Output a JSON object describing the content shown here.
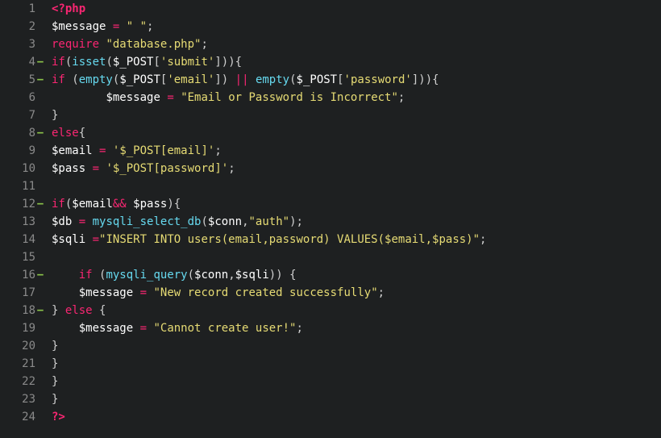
{
  "lines": [
    {
      "n": 1,
      "mark": "",
      "tokens": [
        {
          "c": "tk-tag",
          "t": "<?php"
        }
      ]
    },
    {
      "n": 2,
      "mark": "",
      "tokens": [
        {
          "c": "tk-var",
          "t": "$message"
        },
        {
          "c": "tk-plain",
          "t": " "
        },
        {
          "c": "tk-op",
          "t": "="
        },
        {
          "c": "tk-plain",
          "t": " "
        },
        {
          "c": "tk-str",
          "t": "\" \""
        },
        {
          "c": "tk-punc",
          "t": ";"
        }
      ]
    },
    {
      "n": 3,
      "mark": "",
      "tokens": [
        {
          "c": "tk-keyword",
          "t": "require"
        },
        {
          "c": "tk-plain",
          "t": " "
        },
        {
          "c": "tk-str",
          "t": "\"database.php\""
        },
        {
          "c": "tk-punc",
          "t": ";"
        }
      ]
    },
    {
      "n": 4,
      "mark": "−",
      "tokens": [
        {
          "c": "tk-keyword",
          "t": "if"
        },
        {
          "c": "tk-punc",
          "t": "("
        },
        {
          "c": "tk-func",
          "t": "isset"
        },
        {
          "c": "tk-punc",
          "t": "("
        },
        {
          "c": "tk-var",
          "t": "$_POST"
        },
        {
          "c": "tk-punc",
          "t": "["
        },
        {
          "c": "tk-str",
          "t": "'submit'"
        },
        {
          "c": "tk-punc",
          "t": "])){"
        }
      ]
    },
    {
      "n": 5,
      "mark": "−",
      "tokens": [
        {
          "c": "tk-keyword",
          "t": "if"
        },
        {
          "c": "tk-plain",
          "t": " ("
        },
        {
          "c": "tk-func",
          "t": "empty"
        },
        {
          "c": "tk-punc",
          "t": "("
        },
        {
          "c": "tk-var",
          "t": "$_POST"
        },
        {
          "c": "tk-punc",
          "t": "["
        },
        {
          "c": "tk-str",
          "t": "'email'"
        },
        {
          "c": "tk-punc",
          "t": "]) "
        },
        {
          "c": "tk-op",
          "t": "||"
        },
        {
          "c": "tk-plain",
          "t": " "
        },
        {
          "c": "tk-func",
          "t": "empty"
        },
        {
          "c": "tk-punc",
          "t": "("
        },
        {
          "c": "tk-var",
          "t": "$_POST"
        },
        {
          "c": "tk-punc",
          "t": "["
        },
        {
          "c": "tk-str",
          "t": "'password'"
        },
        {
          "c": "tk-punc",
          "t": "])){"
        }
      ]
    },
    {
      "n": 6,
      "mark": "",
      "tokens": [
        {
          "c": "tk-plain",
          "t": "        "
        },
        {
          "c": "tk-var",
          "t": "$message"
        },
        {
          "c": "tk-plain",
          "t": " "
        },
        {
          "c": "tk-op",
          "t": "="
        },
        {
          "c": "tk-plain",
          "t": " "
        },
        {
          "c": "tk-str",
          "t": "\"Email or Password is Incorrect\""
        },
        {
          "c": "tk-punc",
          "t": ";"
        }
      ]
    },
    {
      "n": 7,
      "mark": "",
      "tokens": [
        {
          "c": "tk-punc",
          "t": "}"
        }
      ]
    },
    {
      "n": 8,
      "mark": "−",
      "tokens": [
        {
          "c": "tk-keyword",
          "t": "else"
        },
        {
          "c": "tk-punc",
          "t": "{"
        }
      ]
    },
    {
      "n": 9,
      "mark": "",
      "tokens": [
        {
          "c": "tk-var",
          "t": "$email"
        },
        {
          "c": "tk-plain",
          "t": " "
        },
        {
          "c": "tk-op",
          "t": "="
        },
        {
          "c": "tk-plain",
          "t": " "
        },
        {
          "c": "tk-str",
          "t": "'$_POST[email]'"
        },
        {
          "c": "tk-punc",
          "t": ";"
        }
      ]
    },
    {
      "n": 10,
      "mark": "",
      "tokens": [
        {
          "c": "tk-var",
          "t": "$pass"
        },
        {
          "c": "tk-plain",
          "t": " "
        },
        {
          "c": "tk-op",
          "t": "="
        },
        {
          "c": "tk-plain",
          "t": " "
        },
        {
          "c": "tk-str",
          "t": "'$_POST[password]'"
        },
        {
          "c": "tk-punc",
          "t": ";"
        }
      ]
    },
    {
      "n": 11,
      "mark": "",
      "tokens": [
        {
          "c": "tk-plain",
          "t": ""
        }
      ]
    },
    {
      "n": 12,
      "mark": "−",
      "tokens": [
        {
          "c": "tk-keyword",
          "t": "if"
        },
        {
          "c": "tk-punc",
          "t": "("
        },
        {
          "c": "tk-var",
          "t": "$email"
        },
        {
          "c": "tk-op",
          "t": "&&"
        },
        {
          "c": "tk-plain",
          "t": " "
        },
        {
          "c": "tk-var",
          "t": "$pass"
        },
        {
          "c": "tk-punc",
          "t": "){"
        }
      ]
    },
    {
      "n": 13,
      "mark": "",
      "tokens": [
        {
          "c": "tk-var",
          "t": "$db"
        },
        {
          "c": "tk-plain",
          "t": " "
        },
        {
          "c": "tk-op",
          "t": "="
        },
        {
          "c": "tk-plain",
          "t": " "
        },
        {
          "c": "tk-func",
          "t": "mysqli_select_db"
        },
        {
          "c": "tk-punc",
          "t": "("
        },
        {
          "c": "tk-var",
          "t": "$conn"
        },
        {
          "c": "tk-punc",
          "t": ","
        },
        {
          "c": "tk-str",
          "t": "\"auth\""
        },
        {
          "c": "tk-punc",
          "t": ");"
        }
      ]
    },
    {
      "n": 14,
      "mark": "",
      "tokens": [
        {
          "c": "tk-var",
          "t": "$sqli"
        },
        {
          "c": "tk-plain",
          "t": " "
        },
        {
          "c": "tk-op",
          "t": "="
        },
        {
          "c": "tk-str",
          "t": "\"INSERT INTO users(email,password) VALUES($email,$pass)\""
        },
        {
          "c": "tk-punc",
          "t": ";"
        }
      ]
    },
    {
      "n": 15,
      "mark": "",
      "tokens": [
        {
          "c": "tk-plain",
          "t": ""
        }
      ]
    },
    {
      "n": 16,
      "mark": "−",
      "tokens": [
        {
          "c": "tk-plain",
          "t": "    "
        },
        {
          "c": "tk-keyword",
          "t": "if"
        },
        {
          "c": "tk-plain",
          "t": " ("
        },
        {
          "c": "tk-func",
          "t": "mysqli_query"
        },
        {
          "c": "tk-punc",
          "t": "("
        },
        {
          "c": "tk-var",
          "t": "$conn"
        },
        {
          "c": "tk-punc",
          "t": ","
        },
        {
          "c": "tk-var",
          "t": "$sqli"
        },
        {
          "c": "tk-punc",
          "t": ")) {"
        }
      ]
    },
    {
      "n": 17,
      "mark": "",
      "tokens": [
        {
          "c": "tk-plain",
          "t": "    "
        },
        {
          "c": "tk-var",
          "t": "$message"
        },
        {
          "c": "tk-plain",
          "t": " "
        },
        {
          "c": "tk-op",
          "t": "="
        },
        {
          "c": "tk-plain",
          "t": " "
        },
        {
          "c": "tk-str",
          "t": "\"New record created successfully\""
        },
        {
          "c": "tk-punc",
          "t": ";"
        }
      ]
    },
    {
      "n": 18,
      "mark": "−",
      "tokens": [
        {
          "c": "tk-punc",
          "t": "} "
        },
        {
          "c": "tk-keyword",
          "t": "else"
        },
        {
          "c": "tk-plain",
          "t": " "
        },
        {
          "c": "tk-punc",
          "t": "{"
        }
      ]
    },
    {
      "n": 19,
      "mark": "",
      "tokens": [
        {
          "c": "tk-plain",
          "t": "    "
        },
        {
          "c": "tk-var",
          "t": "$message"
        },
        {
          "c": "tk-plain",
          "t": " "
        },
        {
          "c": "tk-op",
          "t": "="
        },
        {
          "c": "tk-plain",
          "t": " "
        },
        {
          "c": "tk-str",
          "t": "\"Cannot create user!\""
        },
        {
          "c": "tk-punc",
          "t": ";"
        }
      ]
    },
    {
      "n": 20,
      "mark": "",
      "tokens": [
        {
          "c": "tk-punc",
          "t": "}"
        }
      ]
    },
    {
      "n": 21,
      "mark": "",
      "tokens": [
        {
          "c": "tk-punc",
          "t": "}"
        }
      ]
    },
    {
      "n": 22,
      "mark": "",
      "tokens": [
        {
          "c": "tk-punc",
          "t": "}"
        }
      ]
    },
    {
      "n": 23,
      "mark": "",
      "tokens": [
        {
          "c": "tk-punc",
          "t": "}"
        }
      ]
    },
    {
      "n": 24,
      "mark": "",
      "tokens": [
        {
          "c": "tk-tag",
          "t": "?>"
        }
      ]
    }
  ]
}
